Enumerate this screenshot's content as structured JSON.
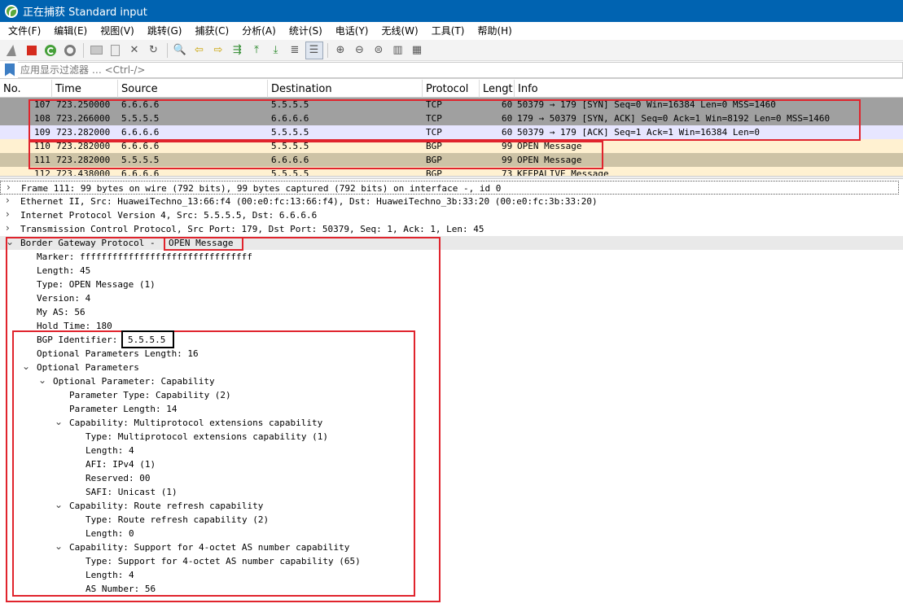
{
  "window": {
    "title": "正在捕获 Standard input"
  },
  "menu": [
    "文件(F)",
    "编辑(E)",
    "视图(V)",
    "跳转(G)",
    "捕获(C)",
    "分析(A)",
    "统计(S)",
    "电话(Y)",
    "无线(W)",
    "工具(T)",
    "帮助(H)"
  ],
  "toolbar": {
    "icons": [
      "shark-fin-icon",
      "stop-icon",
      "restart-icon",
      "options-gear-icon",
      "open-folder-icon",
      "save-icon",
      "close-file-icon",
      "reload-icon",
      "find-icon",
      "go-back-icon",
      "go-forward-icon",
      "go-to-packet-icon",
      "go-first-icon",
      "go-last-icon",
      "auto-scroll-icon",
      "colorize-icon",
      "zoom-in-icon",
      "zoom-out-icon",
      "zoom-normal-icon",
      "resize-columns-icon",
      "layout-icon"
    ]
  },
  "filter": {
    "placeholder": "应用显示过滤器 … <Ctrl-/>"
  },
  "packet_list": {
    "columns": [
      "No.",
      "Time",
      "Source",
      "Destination",
      "Protocol",
      "Lengt",
      "Info"
    ],
    "rows": [
      {
        "no": "107",
        "time": "723.250000",
        "src": "6.6.6.6",
        "dst": "5.5.5.5",
        "proto": "TCP",
        "len": "60",
        "info": "50379 → 179 [SYN] Seq=0 Win=16384 Len=0 MSS=1460"
      },
      {
        "no": "108",
        "time": "723.266000",
        "src": "5.5.5.5",
        "dst": "6.6.6.6",
        "proto": "TCP",
        "len": "60",
        "info": "179 → 50379 [SYN, ACK] Seq=0 Ack=1 Win=8192 Len=0 MSS=1460"
      },
      {
        "no": "109",
        "time": "723.282000",
        "src": "6.6.6.6",
        "dst": "5.5.5.5",
        "proto": "TCP",
        "len": "60",
        "info": "50379 → 179 [ACK] Seq=1 Ack=1 Win=16384 Len=0"
      },
      {
        "no": "110",
        "time": "723.282000",
        "src": "6.6.6.6",
        "dst": "5.5.5.5",
        "proto": "BGP",
        "len": "99",
        "info": "OPEN Message"
      },
      {
        "no": "111",
        "time": "723.282000",
        "src": "5.5.5.5",
        "dst": "6.6.6.6",
        "proto": "BGP",
        "len": "99",
        "info": "OPEN Message"
      },
      {
        "no": "112",
        "time": "723.438000",
        "src": "6.6.6.6",
        "dst": "5.5.5.5",
        "proto": "BGP",
        "len": "73",
        "info": "KEEPALIVE Message"
      }
    ]
  },
  "details": {
    "frame": "Frame 111: 99 bytes on wire (792 bits), 99 bytes captured (792 bits) on interface -, id 0",
    "ethernet": "Ethernet II, Src: HuaweiTechno_13:66:f4 (00:e0:fc:13:66:f4), Dst: HuaweiTechno_3b:33:20 (00:e0:fc:3b:33:20)",
    "ip": "Internet Protocol Version 4, Src: 5.5.5.5, Dst: 6.6.6.6",
    "tcp": "Transmission Control Protocol, Src Port: 179, Dst Port: 50379, Seq: 1, Ack: 1, Len: 45",
    "bgp_prefix": "Border Gateway Protocol - ",
    "bgp_msg": "OPEN Message",
    "marker": "Marker: ffffffffffffffffffffffffffffffff",
    "length": "Length: 45",
    "type": "Type: OPEN Message (1)",
    "version": "Version: 4",
    "my_as": "My AS: 56",
    "hold_time": "Hold Time: 180",
    "bgp_id_label": "BGP Identifier: ",
    "bgp_id_value": "5.5.5.5",
    "opt_params_len": "Optional Parameters Length: 16",
    "opt_params": "Optional Parameters",
    "opt_param": "Optional Parameter: Capability",
    "param_type": "Parameter Type: Capability (2)",
    "param_len": "Parameter Length: 14",
    "cap_mp": "Capability: Multiprotocol extensions capability",
    "cap_mp_type": "Type: Multiprotocol extensions capability (1)",
    "cap_mp_len": "Length: 4",
    "cap_mp_afi": "AFI: IPv4 (1)",
    "cap_mp_res": "Reserved: 00",
    "cap_mp_safi": "SAFI: Unicast (1)",
    "cap_rr": "Capability: Route refresh capability",
    "cap_rr_type": "Type: Route refresh capability (2)",
    "cap_rr_len": "Length: 0",
    "cap_as4": "Capability: Support for 4-octet AS number capability",
    "cap_as4_type": "Type: Support for 4-octet AS number capability (65)",
    "cap_as4_len": "Length: 4",
    "cap_as4_num": "AS Number: 56"
  }
}
